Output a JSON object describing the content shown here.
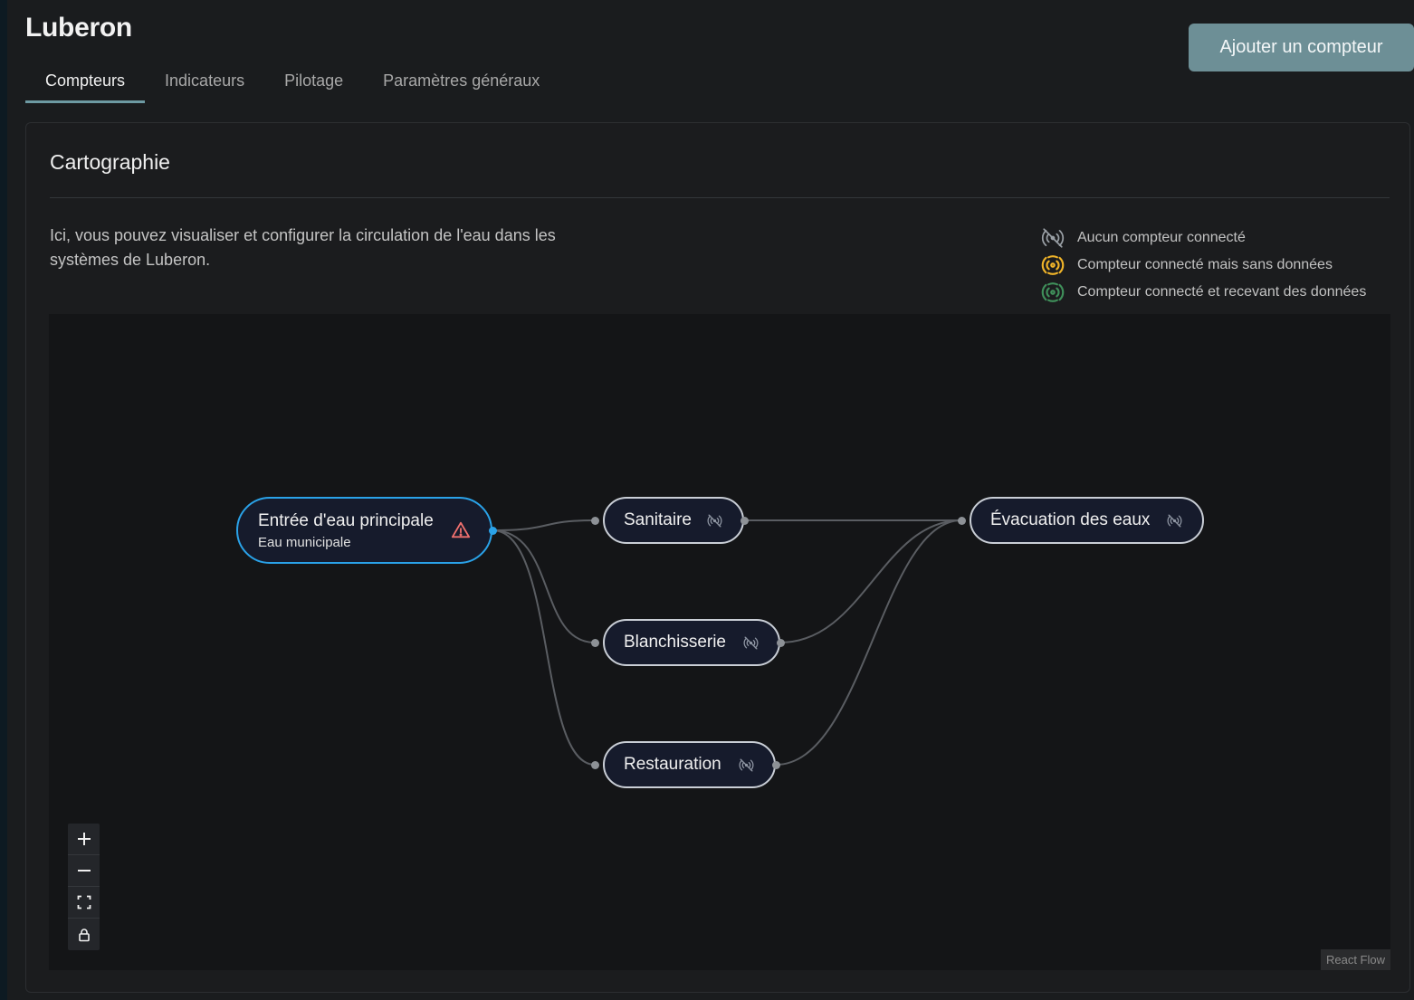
{
  "app": {
    "title": "Luberon",
    "add_button": "Ajouter un compteur"
  },
  "tabs": [
    {
      "label": "Compteurs",
      "active": true
    },
    {
      "label": "Indicateurs",
      "active": false
    },
    {
      "label": "Pilotage",
      "active": false
    },
    {
      "label": "Paramètres généraux",
      "active": false
    }
  ],
  "card": {
    "title": "Cartographie",
    "description": "Ici, vous pouvez visualiser et configurer la circulation de l'eau dans les systèmes de Luberon."
  },
  "legend": [
    {
      "label": "Aucun compteur connecté",
      "icon": "signal-off-icon",
      "color": "#9aa0a6"
    },
    {
      "label": "Compteur connecté mais sans données",
      "icon": "signal-icon",
      "color": "#f0b429"
    },
    {
      "label": "Compteur connecté et recevant des données",
      "icon": "signal-icon",
      "color": "#3f8f5a"
    }
  ],
  "nodes": {
    "main": {
      "label": "Entrée d'eau principale",
      "sublabel": "Eau municipale",
      "icon": "warning-icon",
      "icon_color": "#f0706e",
      "selected": true
    },
    "sanitaire": {
      "label": "Sanitaire",
      "icon": "signal-off-icon"
    },
    "blanchisserie": {
      "label": "Blanchisserie",
      "icon": "signal-off-icon"
    },
    "restauration": {
      "label": "Restauration",
      "icon": "signal-off-icon"
    },
    "evacuation": {
      "label": "Évacuation des eaux",
      "icon": "signal-off-icon"
    }
  },
  "edges": [
    {
      "from": "Entrée d'eau principale",
      "to": "Sanitaire"
    },
    {
      "from": "Entrée d'eau principale",
      "to": "Blanchisserie"
    },
    {
      "from": "Entrée d'eau principale",
      "to": "Restauration"
    },
    {
      "from": "Sanitaire",
      "to": "Évacuation des eaux"
    },
    {
      "from": "Blanchisserie",
      "to": "Évacuation des eaux"
    },
    {
      "from": "Restauration",
      "to": "Évacuation des eaux"
    }
  ],
  "controls": [
    {
      "name": "zoom-in",
      "icon": "plus-icon"
    },
    {
      "name": "zoom-out",
      "icon": "minus-icon"
    },
    {
      "name": "fit-view",
      "icon": "fit-view-icon"
    },
    {
      "name": "lock",
      "icon": "lock-icon"
    }
  ],
  "attribution": "React Flow"
}
